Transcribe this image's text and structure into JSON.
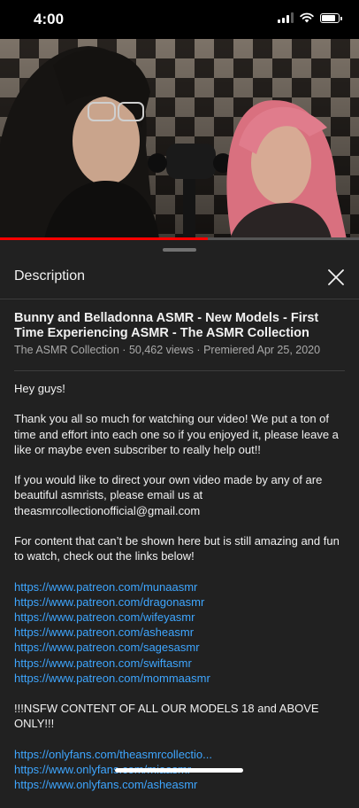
{
  "status": {
    "time": "4:00",
    "battery_level": 0.85
  },
  "player": {
    "progress_fraction": 0.58
  },
  "panel": {
    "title": "Description",
    "video_title": "Bunny and Belladonna ASMR - New Models - First Time Experiencing ASMR - The ASMR Collection",
    "channel": "The ASMR Collection",
    "views": "50,462 views",
    "premiered": "Premiered Apr 25, 2020",
    "separator": "·"
  },
  "description": {
    "greeting": "Hey guys!",
    "paragraph1": "Thank you all so much for watching our video! We put a ton of time and effort into each one so if you enjoyed it, please leave a like or maybe even subscriber to really help out!!",
    "paragraph2_line1": "If you would like to direct your own video made by any of are beautiful asmrists, please email us at",
    "email": "theasmrcollectionofficial@gmail.com",
    "paragraph3": "For content that can’t be shown here but is still amazing and fun to watch, check out the links below!",
    "patreon_links": [
      "https://www.patreon.com/munaasmr",
      "https://www.patreon.com/dragonasmr",
      "https://www.patreon.com/wifeyasmr",
      "https://www.patreon.com/asheasmr",
      "https://www.patreon.com/sagesasmr",
      "https://www.patreon.com/swiftasmr",
      "https://www.patreon.com/mommaasmr"
    ],
    "nsfw_notice": "!!!NSFW CONTENT OF ALL OUR MODELS 18 and ABOVE ONLY!!!",
    "onlyfans_links": [
      "https://onlyfans.com/theasmrcollectio...",
      "https://www.onlyfans.com/miaasmr",
      "https://www.onlyfans.com/asheasmr"
    ]
  }
}
